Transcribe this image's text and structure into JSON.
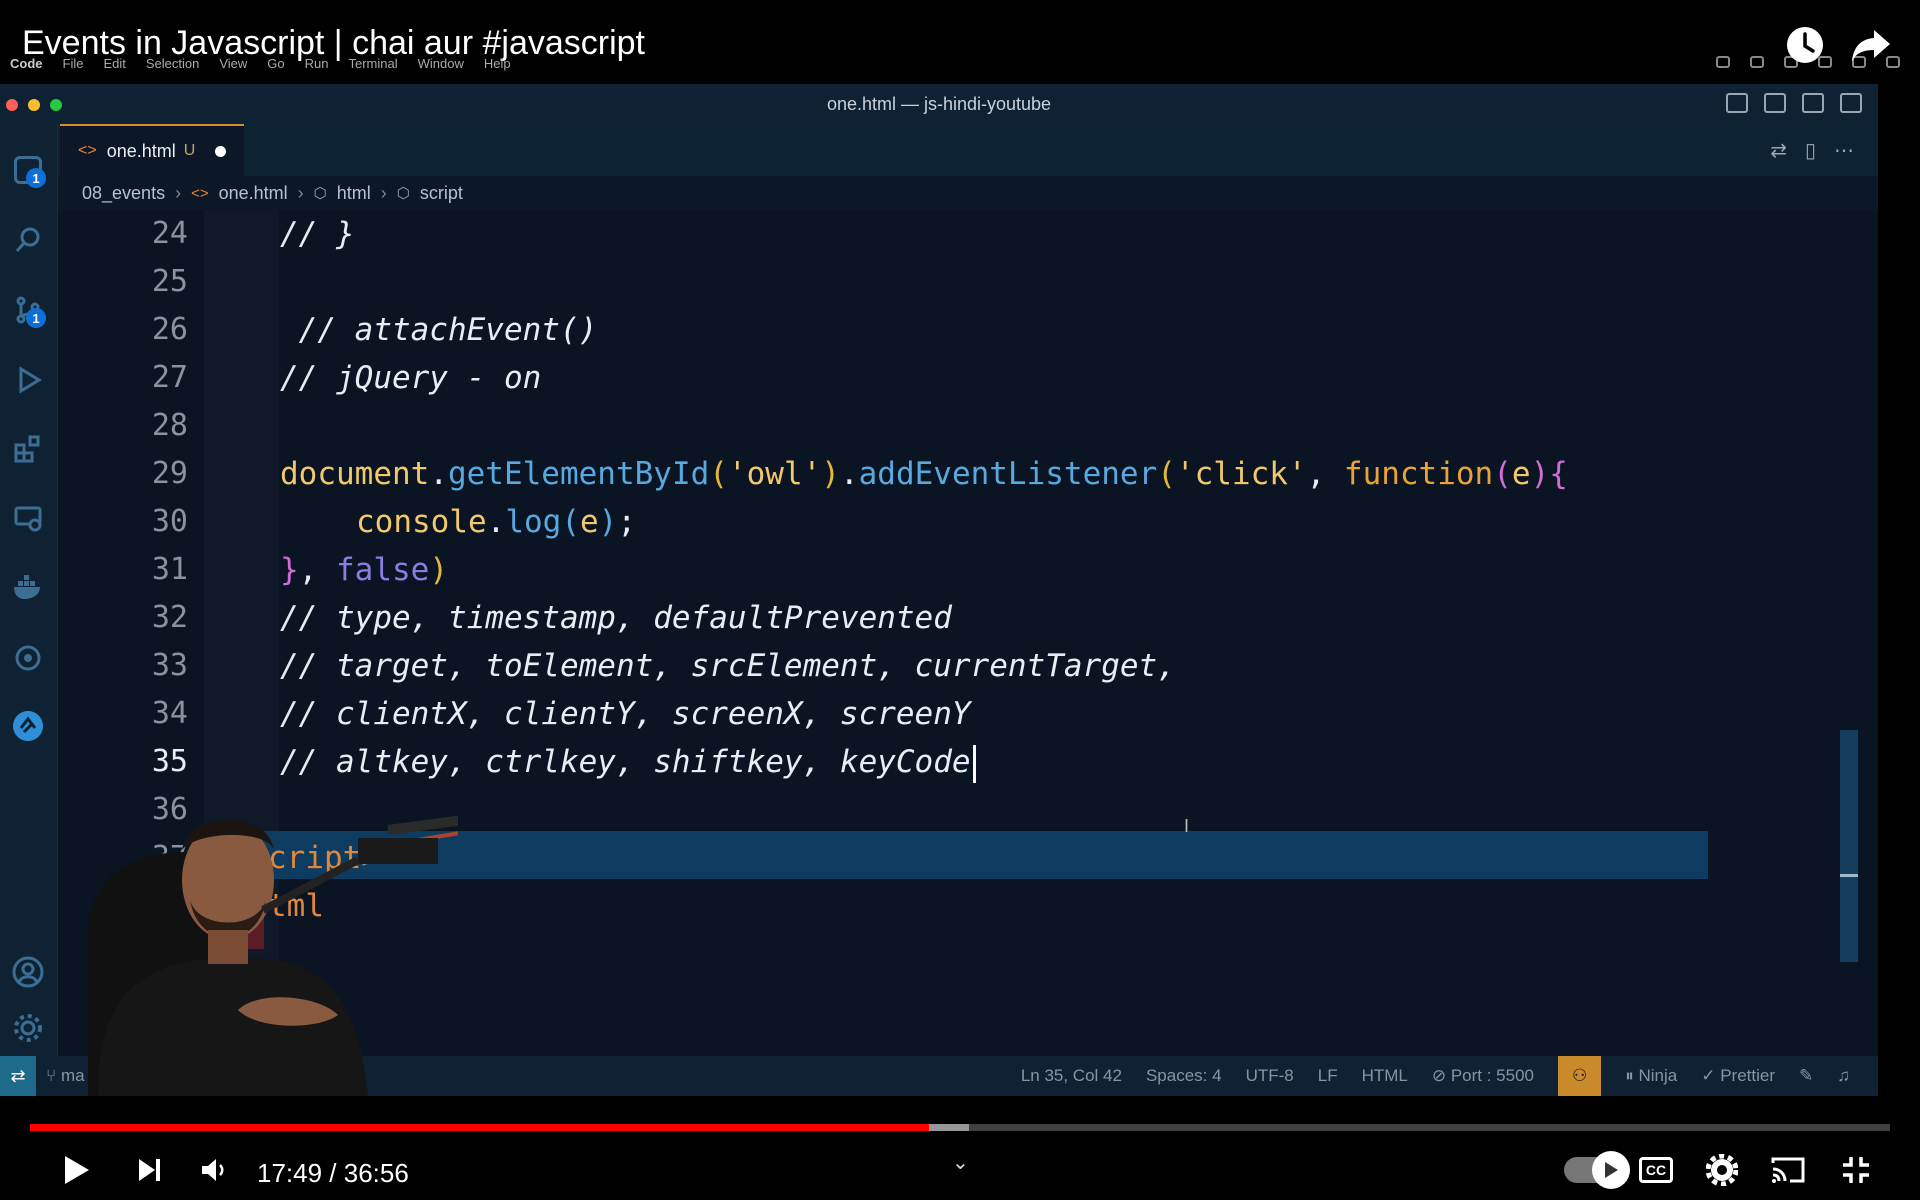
{
  "video": {
    "title": "Events in Javascript | chai aur #javascript",
    "current_time": "17:49",
    "duration": "36:56",
    "time_display": "17:49 / 36:56",
    "progress_played": 0.4835,
    "progress_buffered": 0.505
  },
  "mac_menu": [
    "Code",
    "File",
    "Edit",
    "Selection",
    "View",
    "Go",
    "Run",
    "Terminal",
    "Window",
    "Help"
  ],
  "vscode": {
    "window_title": "one.html — js-hindi-youtube",
    "tab": {
      "label": "one.html",
      "status": "U"
    },
    "breadcrumb": [
      "08_events",
      "one.html",
      "html",
      "script"
    ],
    "activity_badges": {
      "explorer": "1",
      "source_control": "1"
    },
    "editor": {
      "lines": [
        {
          "num": "24"
        },
        {
          "num": "25"
        },
        {
          "num": "26"
        },
        {
          "num": "27"
        },
        {
          "num": "28"
        },
        {
          "num": "29"
        },
        {
          "num": "30"
        },
        {
          "num": "31"
        },
        {
          "num": "32"
        },
        {
          "num": "33"
        },
        {
          "num": "34"
        },
        {
          "num": "35"
        },
        {
          "num": "36"
        },
        {
          "num": "37"
        },
        {
          "num": "38"
        }
      ],
      "code": {
        "l24": "// }",
        "l26": " // attachEvent()",
        "l27": "// jQuery - on",
        "l29_document": "document",
        "l29_dot1": ".",
        "l29_getById": "getElementById",
        "l29_p1": "(",
        "l29_owl": "'owl'",
        "l29_p2": ")",
        "l29_dot2": ".",
        "l29_addListener": "addEventListener",
        "l29_p3": "(",
        "l29_click": "'click'",
        "l29_comma": ", ",
        "l29_function": "function",
        "l29_p4": "(",
        "l29_e": "e",
        "l29_p5": ")",
        "l29_brace": "{",
        "l30_console": "console",
        "l30_dot": ".",
        "l30_log": "log",
        "l30_p1": "(",
        "l30_e": "e",
        "l30_p2": ")",
        "l30_semi": ";",
        "l31_brace": "}",
        "l31_comma": ", ",
        "l31_false": "false",
        "l31_paren": ")",
        "l32": "// type, timestamp, defaultPrevented",
        "l33": "// target, toElement, srcElement, currentTarget,",
        "l34": "// clientX, clientY, screenX, screenY",
        "l35": "// altkey, ctrlkey, shiftkey, keyCode",
        "l37_tag": "cript",
        "l37_close": ">",
        "l38_tag": "tml"
      }
    },
    "status_bar": {
      "branch": "ma",
      "position": "Ln 35, Col 42",
      "spaces": "Spaces: 4",
      "encoding": "UTF-8",
      "eol": "LF",
      "language": "HTML",
      "port": "Port : 5500",
      "ninja": "Ninja",
      "prettier": "Prettier"
    }
  },
  "colors": {
    "progress_red": "#ff0000",
    "tab_accent": "#e08b2b",
    "editor_bg": "#0b1422",
    "line_highlight": "#0e3b60"
  }
}
